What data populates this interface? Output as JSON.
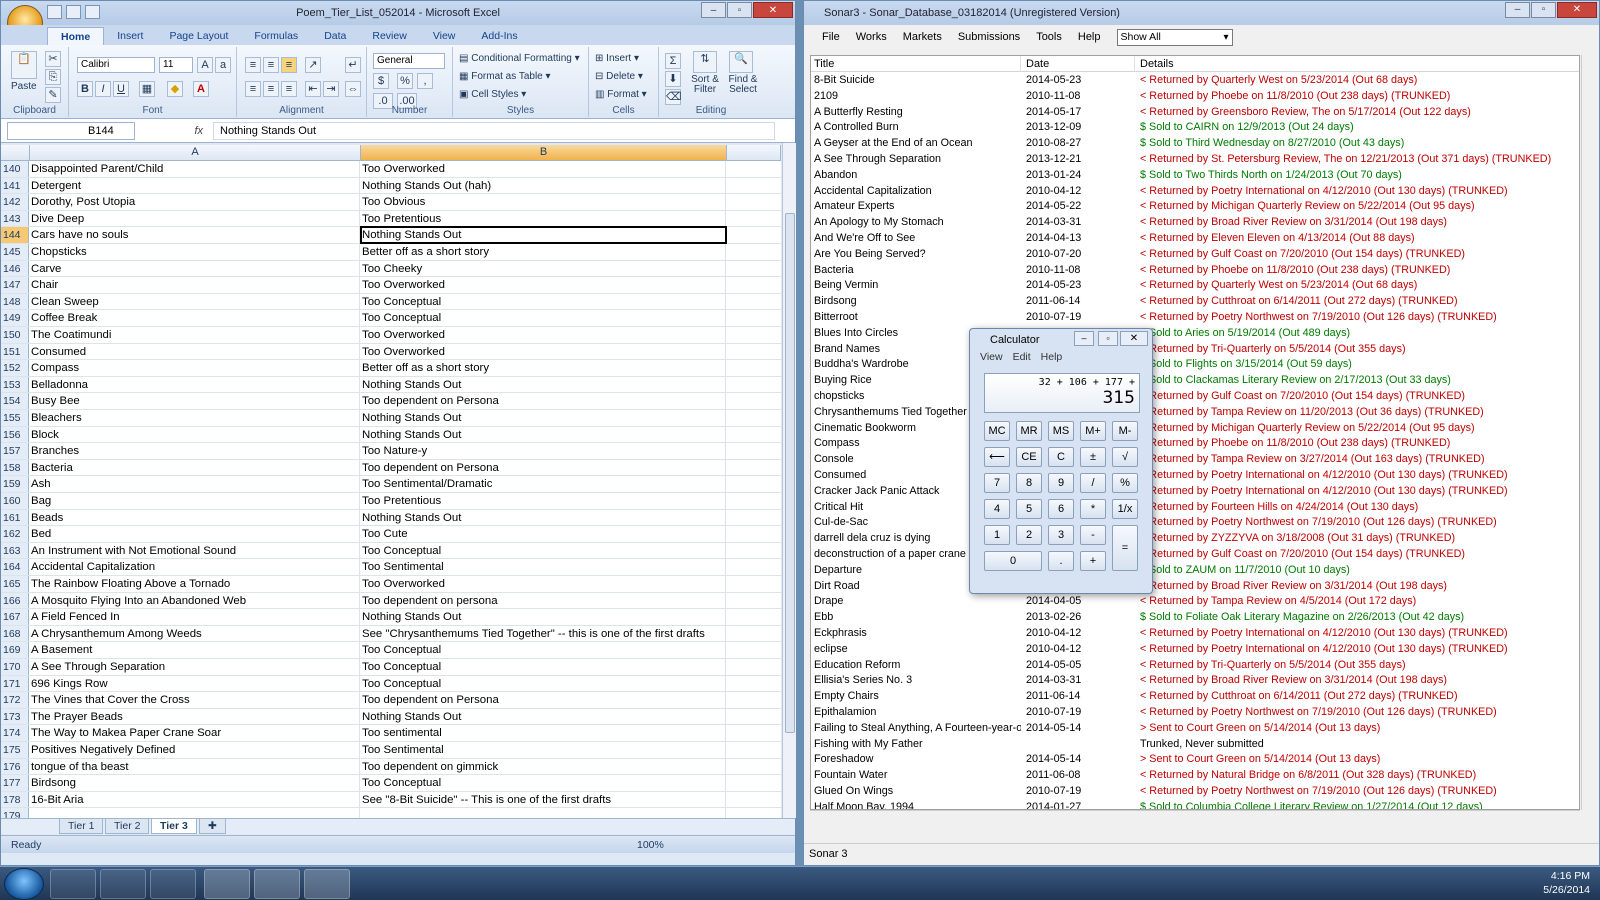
{
  "excel": {
    "title": "Poem_Tier_List_052014 - Microsoft Excel",
    "tabs": [
      "Home",
      "Insert",
      "Page Layout",
      "Formulas",
      "Data",
      "Review",
      "View",
      "Add-Ins"
    ],
    "ribbon": {
      "paste": "Paste",
      "font_name": "Calibri",
      "font_size": "11",
      "number_format": "General",
      "cond_format": "Conditional Formatting",
      "format_table": "Format as Table",
      "cell_styles": "Cell Styles",
      "insert": "Insert",
      "delete": "Delete",
      "format": "Format",
      "sort": "Sort & Filter",
      "find": "Find & Select",
      "groups": [
        "Clipboard",
        "Font",
        "Alignment",
        "Number",
        "Styles",
        "Cells",
        "Editing"
      ]
    },
    "name_box": "B144",
    "fx": "fx",
    "formula": "Nothing Stands Out",
    "col_a": "A",
    "col_b": "B",
    "rows": [
      {
        "n": "140",
        "a": "Disappointed Parent/Child",
        "b": "Too Overworked"
      },
      {
        "n": "141",
        "a": "Detergent",
        "b": "Nothing Stands Out (hah)"
      },
      {
        "n": "142",
        "a": "Dorothy, Post Utopia",
        "b": "Too Obvious"
      },
      {
        "n": "143",
        "a": "Dive Deep",
        "b": "Too Pretentious"
      },
      {
        "n": "144",
        "a": "Cars have no souls",
        "b": "Nothing Stands Out"
      },
      {
        "n": "145",
        "a": "Chopsticks",
        "b": "Better off as a short story"
      },
      {
        "n": "146",
        "a": "Carve",
        "b": "Too Cheeky"
      },
      {
        "n": "147",
        "a": "Chair",
        "b": "Too Overworked"
      },
      {
        "n": "148",
        "a": "Clean Sweep",
        "b": "Too Conceptual"
      },
      {
        "n": "149",
        "a": "Coffee Break",
        "b": "Too Conceptual"
      },
      {
        "n": "150",
        "a": "The Coatimundi",
        "b": "Too Overworked"
      },
      {
        "n": "151",
        "a": "Consumed",
        "b": "Too Overworked"
      },
      {
        "n": "152",
        "a": "Compass",
        "b": "Better off as a short story"
      },
      {
        "n": "153",
        "a": "Belladonna",
        "b": "Nothing Stands Out"
      },
      {
        "n": "154",
        "a": "Busy Bee",
        "b": "Too dependent on Persona"
      },
      {
        "n": "155",
        "a": "Bleachers",
        "b": "Nothing Stands Out"
      },
      {
        "n": "156",
        "a": "Block",
        "b": "Nothing Stands Out"
      },
      {
        "n": "157",
        "a": "Branches",
        "b": "Too Nature-y"
      },
      {
        "n": "158",
        "a": "Bacteria",
        "b": "Too dependent on Persona"
      },
      {
        "n": "159",
        "a": "Ash",
        "b": "Too Sentimental/Dramatic"
      },
      {
        "n": "160",
        "a": "Bag",
        "b": "Too Pretentious"
      },
      {
        "n": "161",
        "a": "Beads",
        "b": "Nothing Stands Out"
      },
      {
        "n": "162",
        "a": "Bed",
        "b": "Too Cute"
      },
      {
        "n": "163",
        "a": "An Instrument with Not Emotional Sound",
        "b": "Too Conceptual"
      },
      {
        "n": "164",
        "a": "Accidental Capitalization",
        "b": "Too Sentimental"
      },
      {
        "n": "165",
        "a": "The Rainbow Floating Above a Tornado",
        "b": "Too Overworked"
      },
      {
        "n": "166",
        "a": "A Mosquito Flying Into an Abandoned Web",
        "b": "Too  dependent on persona"
      },
      {
        "n": "167",
        "a": "A Field Fenced In",
        "b": "Nothing Stands Out"
      },
      {
        "n": "168",
        "a": "A Chrysanthemum Among Weeds",
        "b": "See \"Chrysanthemums Tied Together\" -- this is one of the first drafts"
      },
      {
        "n": "169",
        "a": "A Basement",
        "b": "Too Conceptual"
      },
      {
        "n": "170",
        "a": "A See Through Separation",
        "b": "Too Conceptual"
      },
      {
        "n": "171",
        "a": "696 Kings Row",
        "b": "Too Conceptual"
      },
      {
        "n": "172",
        "a": "The Vines that Cover the Cross",
        "b": "Too dependent on Persona"
      },
      {
        "n": "173",
        "a": "The Prayer Beads",
        "b": "Nothing Stands Out"
      },
      {
        "n": "174",
        "a": "The Way to Makea Paper Crane Soar",
        "b": "Too sentimental"
      },
      {
        "n": "175",
        "a": "Positives Negatively Defined",
        "b": "Too Sentimental"
      },
      {
        "n": "176",
        "a": "tongue of tha beast",
        "b": "Too dependent on gimmick"
      },
      {
        "n": "177",
        "a": "Birdsong",
        "b": "Too Conceptual"
      },
      {
        "n": "178",
        "a": "16-Bit Aria",
        "b": "See \"8-Bit Suicide\" -- This is one of the first drafts"
      },
      {
        "n": "179",
        "a": "",
        "b": ""
      }
    ],
    "sheet_tabs": [
      "Tier 1",
      "Tier 2",
      "Tier 3"
    ],
    "status": "Ready",
    "zoom": "100%"
  },
  "sonar": {
    "title": "Sonar3 - Sonar_Database_03182014 (Unregistered Version)",
    "menu": [
      "File",
      "Works",
      "Markets",
      "Submissions",
      "Tools",
      "Help"
    ],
    "filter": "Show All",
    "headers": {
      "title": "Title",
      "date": "Date",
      "details": "Details"
    },
    "rows": [
      {
        "t": "8-Bit Suicide",
        "d": "2014-05-23",
        "x": "< Returned by Quarterly West on 5/23/2014 (Out 68 days)",
        "c": "red"
      },
      {
        "t": "2109",
        "d": "2010-11-08",
        "x": "< Returned by Phoebe on 11/8/2010 (Out 238 days)  (TRUNKED)",
        "c": "red"
      },
      {
        "t": "A Butterfly Resting",
        "d": "2014-05-17",
        "x": "< Returned by Greensboro Review, The on 5/17/2014 (Out 122 days)",
        "c": "red"
      },
      {
        "t": "A Controlled Burn",
        "d": "2013-12-09",
        "x": "$ Sold to CAIRN on 12/9/2013 (Out 24 days)",
        "c": "green"
      },
      {
        "t": "A Geyser at the End of an Ocean",
        "d": "2010-08-27",
        "x": "$ Sold to Third Wednesday on 8/27/2010 (Out 43 days)",
        "c": "green"
      },
      {
        "t": "A See Through Separation",
        "d": "2013-12-21",
        "x": "< Returned by St. Petersburg Review, The on 12/21/2013 (Out 371 days)  (TRUNKED)",
        "c": "red"
      },
      {
        "t": "Abandon",
        "d": "2013-01-24",
        "x": "$ Sold to Two Thirds North on 1/24/2013 (Out 70 days)",
        "c": "green"
      },
      {
        "t": "Accidental Capitalization",
        "d": "2010-04-12",
        "x": "< Returned by Poetry International on 4/12/2010 (Out 130 days)  (TRUNKED)",
        "c": "red"
      },
      {
        "t": "Amateur Experts",
        "d": "2014-05-22",
        "x": "< Returned by Michigan Quarterly Review on 5/22/2014 (Out 95 days)",
        "c": "red"
      },
      {
        "t": "An Apology to My Stomach",
        "d": "2014-03-31",
        "x": "< Returned by Broad River Review on 3/31/2014 (Out 198 days)",
        "c": "red"
      },
      {
        "t": "And We're Off to See",
        "d": "2014-04-13",
        "x": "< Returned by Eleven Eleven on 4/13/2014 (Out 88 days)",
        "c": "red"
      },
      {
        "t": "Are You Being Served?",
        "d": "2010-07-20",
        "x": "< Returned by Gulf Coast on 7/20/2010 (Out 154 days)  (TRUNKED)",
        "c": "red"
      },
      {
        "t": "Bacteria",
        "d": "2010-11-08",
        "x": "< Returned by Phoebe on 11/8/2010 (Out 238 days)  (TRUNKED)",
        "c": "red"
      },
      {
        "t": "Being Vermin",
        "d": "2014-05-23",
        "x": "< Returned by Quarterly West on 5/23/2014 (Out 68 days)",
        "c": "red"
      },
      {
        "t": "Birdsong",
        "d": "2011-06-14",
        "x": "< Returned by Cutthroat on 6/14/2011 (Out 272 days)  (TRUNKED)",
        "c": "red"
      },
      {
        "t": "Bitterroot",
        "d": "2010-07-19",
        "x": "< Returned by Poetry Northwest on 7/19/2010 (Out 126 days)  (TRUNKED)",
        "c": "red"
      },
      {
        "t": "Blues Into Circles",
        "d": "",
        "x": "$ Sold to Aries on 5/19/2014 (Out 489 days)",
        "c": "green"
      },
      {
        "t": "Brand Names",
        "d": "",
        "x": "< Returned by Tri-Quarterly on 5/5/2014 (Out 355 days)",
        "c": "red"
      },
      {
        "t": "Buddha's Wardrobe",
        "d": "",
        "x": "$ Sold to Flights on 3/15/2014 (Out 59 days)",
        "c": "green"
      },
      {
        "t": "Buying Rice",
        "d": "",
        "x": "$ Sold to Clackamas Literary Review on 2/17/2013 (Out 33 days)",
        "c": "green"
      },
      {
        "t": "chopsticks",
        "d": "",
        "x": "< Returned by Gulf Coast on 7/20/2010 (Out 154 days)  (TRUNKED)",
        "c": "red"
      },
      {
        "t": "Chrysanthemums Tied Together",
        "d": "",
        "x": "< Returned by Tampa Review on 11/20/2013 (Out 36 days)  (TRUNKED)",
        "c": "red"
      },
      {
        "t": "Cinematic Bookworm",
        "d": "",
        "x": "< Returned by Michigan Quarterly Review on 5/22/2014 (Out 95 days)",
        "c": "red"
      },
      {
        "t": "Compass",
        "d": "",
        "x": "< Returned by Phoebe on 11/8/2010 (Out 238 days)  (TRUNKED)",
        "c": "red"
      },
      {
        "t": "Console",
        "d": "",
        "x": "< Returned by Tampa Review on 3/27/2014 (Out 163 days)  (TRUNKED)",
        "c": "red"
      },
      {
        "t": "Consumed",
        "d": "",
        "x": "< Returned by Poetry International on 4/12/2010 (Out 130 days)  (TRUNKED)",
        "c": "red"
      },
      {
        "t": "Cracker Jack Panic Attack",
        "d": "",
        "x": "< Returned by Poetry International on 4/12/2010 (Out 130 days)  (TRUNKED)",
        "c": "red"
      },
      {
        "t": "Critical Hit",
        "d": "",
        "x": "< Returned by Fourteen Hills on 4/24/2014 (Out 130 days)",
        "c": "red"
      },
      {
        "t": "Cul-de-Sac",
        "d": "",
        "x": "< Returned by Poetry Northwest on 7/19/2010 (Out 126 days)  (TRUNKED)",
        "c": "red"
      },
      {
        "t": "darrell dela cruz is dying",
        "d": "",
        "x": "< Returned by ZYZZYVA on 3/18/2008 (Out 31 days)  (TRUNKED)",
        "c": "red"
      },
      {
        "t": "deconstruction of a paper crane",
        "d": "",
        "x": "< Returned by Gulf Coast on 7/20/2010 (Out 154 days)  (TRUNKED)",
        "c": "red"
      },
      {
        "t": "Departure",
        "d": "",
        "x": "$ Sold to ZAUM on 11/7/2010 (Out 10 days)",
        "c": "green"
      },
      {
        "t": "Dirt Road",
        "d": "",
        "x": "< Returned by Broad River Review on 3/31/2014 (Out 198 days)",
        "c": "red"
      },
      {
        "t": "Drape",
        "d": "2014-04-05",
        "x": "< Returned by Tampa Review on 4/5/2014 (Out 172 days)",
        "c": "red"
      },
      {
        "t": "Ebb",
        "d": "2013-02-26",
        "x": "$ Sold to Foliate Oak Literary Magazine on 2/26/2013 (Out 42 days)",
        "c": "green"
      },
      {
        "t": "Eckphrasis",
        "d": "2010-04-12",
        "x": "< Returned by Poetry International on 4/12/2010 (Out 130 days)  (TRUNKED)",
        "c": "red"
      },
      {
        "t": "eclipse",
        "d": "2010-04-12",
        "x": "< Returned by Poetry International on 4/12/2010 (Out 130 days)  (TRUNKED)",
        "c": "red"
      },
      {
        "t": "Education Reform",
        "d": "2014-05-05",
        "x": "< Returned by Tri-Quarterly on 5/5/2014 (Out 355 days)",
        "c": "red"
      },
      {
        "t": "Ellisia's Series No. 3",
        "d": "2014-03-31",
        "x": "< Returned by Broad River Review on 3/31/2014 (Out 198 days)",
        "c": "red"
      },
      {
        "t": "Empty Chairs",
        "d": "2011-06-14",
        "x": "< Returned by Cutthroat on 6/14/2011 (Out 272 days)  (TRUNKED)",
        "c": "red"
      },
      {
        "t": "Epithalamion",
        "d": "2010-07-19",
        "x": "< Returned by Poetry Northwest on 7/19/2010 (Out 126 days)  (TRUNKED)",
        "c": "red"
      },
      {
        "t": "Failing to Steal Anything, A Fourteen-year-old...",
        "d": "2014-05-14",
        "x": "> Sent to Court Green on 5/14/2014 (Out 13 days)",
        "c": "red"
      },
      {
        "t": "Fishing with My Father",
        "d": "",
        "x": "Trunked, Never submitted",
        "c": "blk"
      },
      {
        "t": "Foreshadow",
        "d": "2014-05-14",
        "x": "> Sent to Court Green on 5/14/2014 (Out 13 days)",
        "c": "red"
      },
      {
        "t": "Fountain Water",
        "d": "2011-06-08",
        "x": "< Returned by Natural Bridge on 6/8/2011 (Out 328 days)  (TRUNKED)",
        "c": "red"
      },
      {
        "t": "Glued On Wings",
        "d": "2010-07-19",
        "x": "< Returned by Poetry Northwest on 7/19/2010 (Out 126 days)  (TRUNKED)",
        "c": "red"
      },
      {
        "t": "Half Moon Bay, 1994",
        "d": "2014-01-27",
        "x": "$ Sold to Columbia College Literary Review on 1/27/2014 (Out 12 days)",
        "c": "green"
      }
    ],
    "status": "Sonar 3"
  },
  "calc": {
    "title": "Calculator",
    "menu": [
      "View",
      "Edit",
      "Help"
    ],
    "expr": "32 + 106 + 177 +",
    "value": "315",
    "mem": [
      "MC",
      "MR",
      "MS",
      "M+",
      "M-"
    ],
    "r2": [
      "⟵",
      "CE",
      "C",
      "±",
      "√"
    ],
    "r3": [
      "7",
      "8",
      "9",
      "/",
      "%"
    ],
    "r4": [
      "4",
      "5",
      "6",
      "*",
      "1/x"
    ],
    "r5": [
      "1",
      "2",
      "3",
      "-",
      "="
    ],
    "r6": [
      "0",
      ".",
      "+"
    ]
  },
  "tray": {
    "time": "4:16 PM",
    "date": "5/26/2014"
  }
}
